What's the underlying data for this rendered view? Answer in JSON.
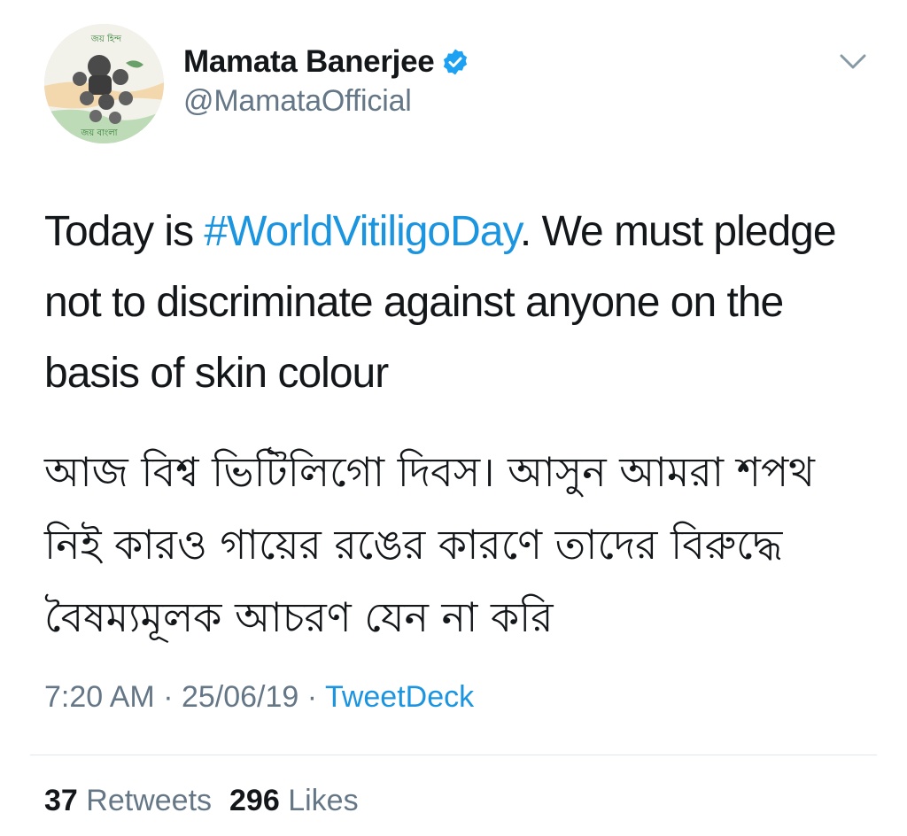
{
  "author": {
    "display_name": "Mamata Banerjee",
    "handle": "@MamataOfficial",
    "verified": true,
    "avatar_text_top": "জয় হিন্দ",
    "avatar_text_bottom": "জয় বাংলা"
  },
  "tweet": {
    "text_before_hashtag": "Today is ",
    "hashtag": "#WorldVitiligoDay",
    "text_after_hashtag": ". We must pledge not to discriminate against anyone on the basis of skin colour",
    "bengali_text": "আজ বিশ্ব ভিটিলিগো দিবস। আসুন আমরা শপথ নিই কারও গায়ের রঙের কারণে তাদের বিরুদ্ধে বৈষম্যমূলক আচরণ যেন না করি"
  },
  "meta": {
    "time": "7:20 AM",
    "separator1": " · ",
    "date": "25/06/19",
    "separator2": " · ",
    "source": "TweetDeck"
  },
  "stats": {
    "retweets_count": "37",
    "retweets_label": "Retweets",
    "likes_count": "296",
    "likes_label": "Likes"
  },
  "icons": {
    "verified": "verified-badge-icon",
    "caret": "chevron-down-icon"
  },
  "colors": {
    "text": "#14171a",
    "secondary": "#657786",
    "link": "#1b95e0",
    "verified": "#1da1f2",
    "divider": "#e1e8ed"
  }
}
